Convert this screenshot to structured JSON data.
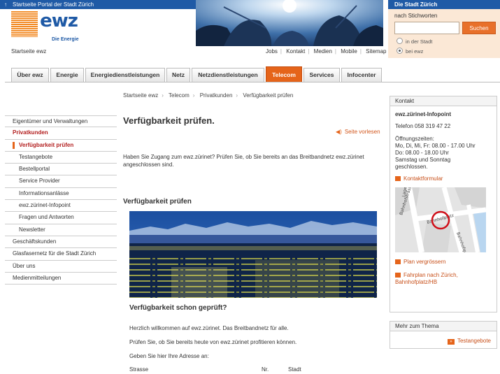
{
  "topbar": {
    "portal_link": "Startseite Portal der Stadt Zürich",
    "stadt_title": "Die Stadt Zürich"
  },
  "logo": {
    "brand": "ewz",
    "tagline": "Die Energie"
  },
  "header": {
    "startseite": "Startseite ewz",
    "meta_nav": [
      "Jobs",
      "Kontakt",
      "Medien",
      "Mobile",
      "Sitemap"
    ]
  },
  "search": {
    "label": "nach Stichworten",
    "value": "",
    "button": "Suchen",
    "options": [
      "in der Stadt",
      "bei ewz"
    ],
    "selected": "bei ewz"
  },
  "tabs": [
    "Über ewz",
    "Energie",
    "Energiedienstleistungen",
    "Netz",
    "Netzdienstleistungen",
    "Telecom",
    "Services",
    "Infocenter"
  ],
  "active_tab": "Telecom",
  "breadcrumb": [
    "Startseite ewz",
    "Telecom",
    "Privatkunden",
    "Verfügbarkeit prüfen"
  ],
  "leftnav": [
    {
      "label": "Eigentümer und Verwaltungen",
      "level": 0
    },
    {
      "label": "Privatkunden",
      "level": 0,
      "selected": true
    },
    {
      "label": "Verfügbarkeit prüfen",
      "level": 1,
      "selected": true
    },
    {
      "label": "Testangebote",
      "level": 1
    },
    {
      "label": "Bestellportal",
      "level": 1
    },
    {
      "label": "Service Provider",
      "level": 1
    },
    {
      "label": "Informationsanlässe",
      "level": 1
    },
    {
      "label": "ewz.zürinet-Infopoint",
      "level": 1
    },
    {
      "label": "Fragen und Antworten",
      "level": 1
    },
    {
      "label": "Newsletter",
      "level": 1
    },
    {
      "label": "Geschäftskunden",
      "level": 0
    },
    {
      "label": "Glasfasernetz für die Stadt Zürich",
      "level": 0
    },
    {
      "label": "Über uns",
      "level": 0
    },
    {
      "label": "Medienmitteilungen",
      "level": 0
    }
  ],
  "main": {
    "title": "Verfügbarkeit prüfen.",
    "vorlesen": "Seite vorlesen",
    "intro": "Haben Sie Zugang zum ewz.zürinet? Prüfen Sie, ob Sie bereits an das Breitbandnetz ewz.zürinet angeschlossen sind.",
    "section_title": "Verfügbarkeit prüfen",
    "checked_title": "Verfügbarkeit schon geprüft?",
    "welcome": "Herzlich willkommen auf ewz.zürinet. Das Breitbandnetz für alle.",
    "pruefen": "Prüfen Sie, ob Sie bereits heute von ewz.zürinet profitieren können.",
    "adresse": "Geben Sie hier Ihre Adresse an:",
    "columns": {
      "strasse": "Strasse",
      "nr": "Nr.",
      "stadt": "Stadt"
    }
  },
  "kontakt": {
    "header": "Kontakt",
    "name": "ewz.zürinet-Infopoint",
    "telefon": "Telefon  058 319 47 22",
    "hours_title": "Öffnungszeiten:",
    "hours_1": "Mo, Di, Mi, Fr: 08.00 - 17.00 Uhr",
    "hours_2": "Do: 08.00 - 18.00 Uhr",
    "hours_3": "Samstag und Sonntag",
    "hours_4": "geschlossen.",
    "kontaktformular": "Kontaktformular",
    "map_labels": [
      "Lagerstrasse",
      "Bahnhofquai",
      "Bahnhofplatz",
      "Bahnhofstrasse"
    ],
    "plan": "Plan vergrössern",
    "fahrplan_1": "Fahrplan nach Zürich,",
    "fahrplan_2": "Bahnhofplatz/HB"
  },
  "thema": {
    "header": "Mehr zum Thema",
    "link": "Testangebote"
  },
  "colors": {
    "blue": "#1f5aa6",
    "orange": "#e5641a",
    "selected_nav": "#b32020"
  }
}
